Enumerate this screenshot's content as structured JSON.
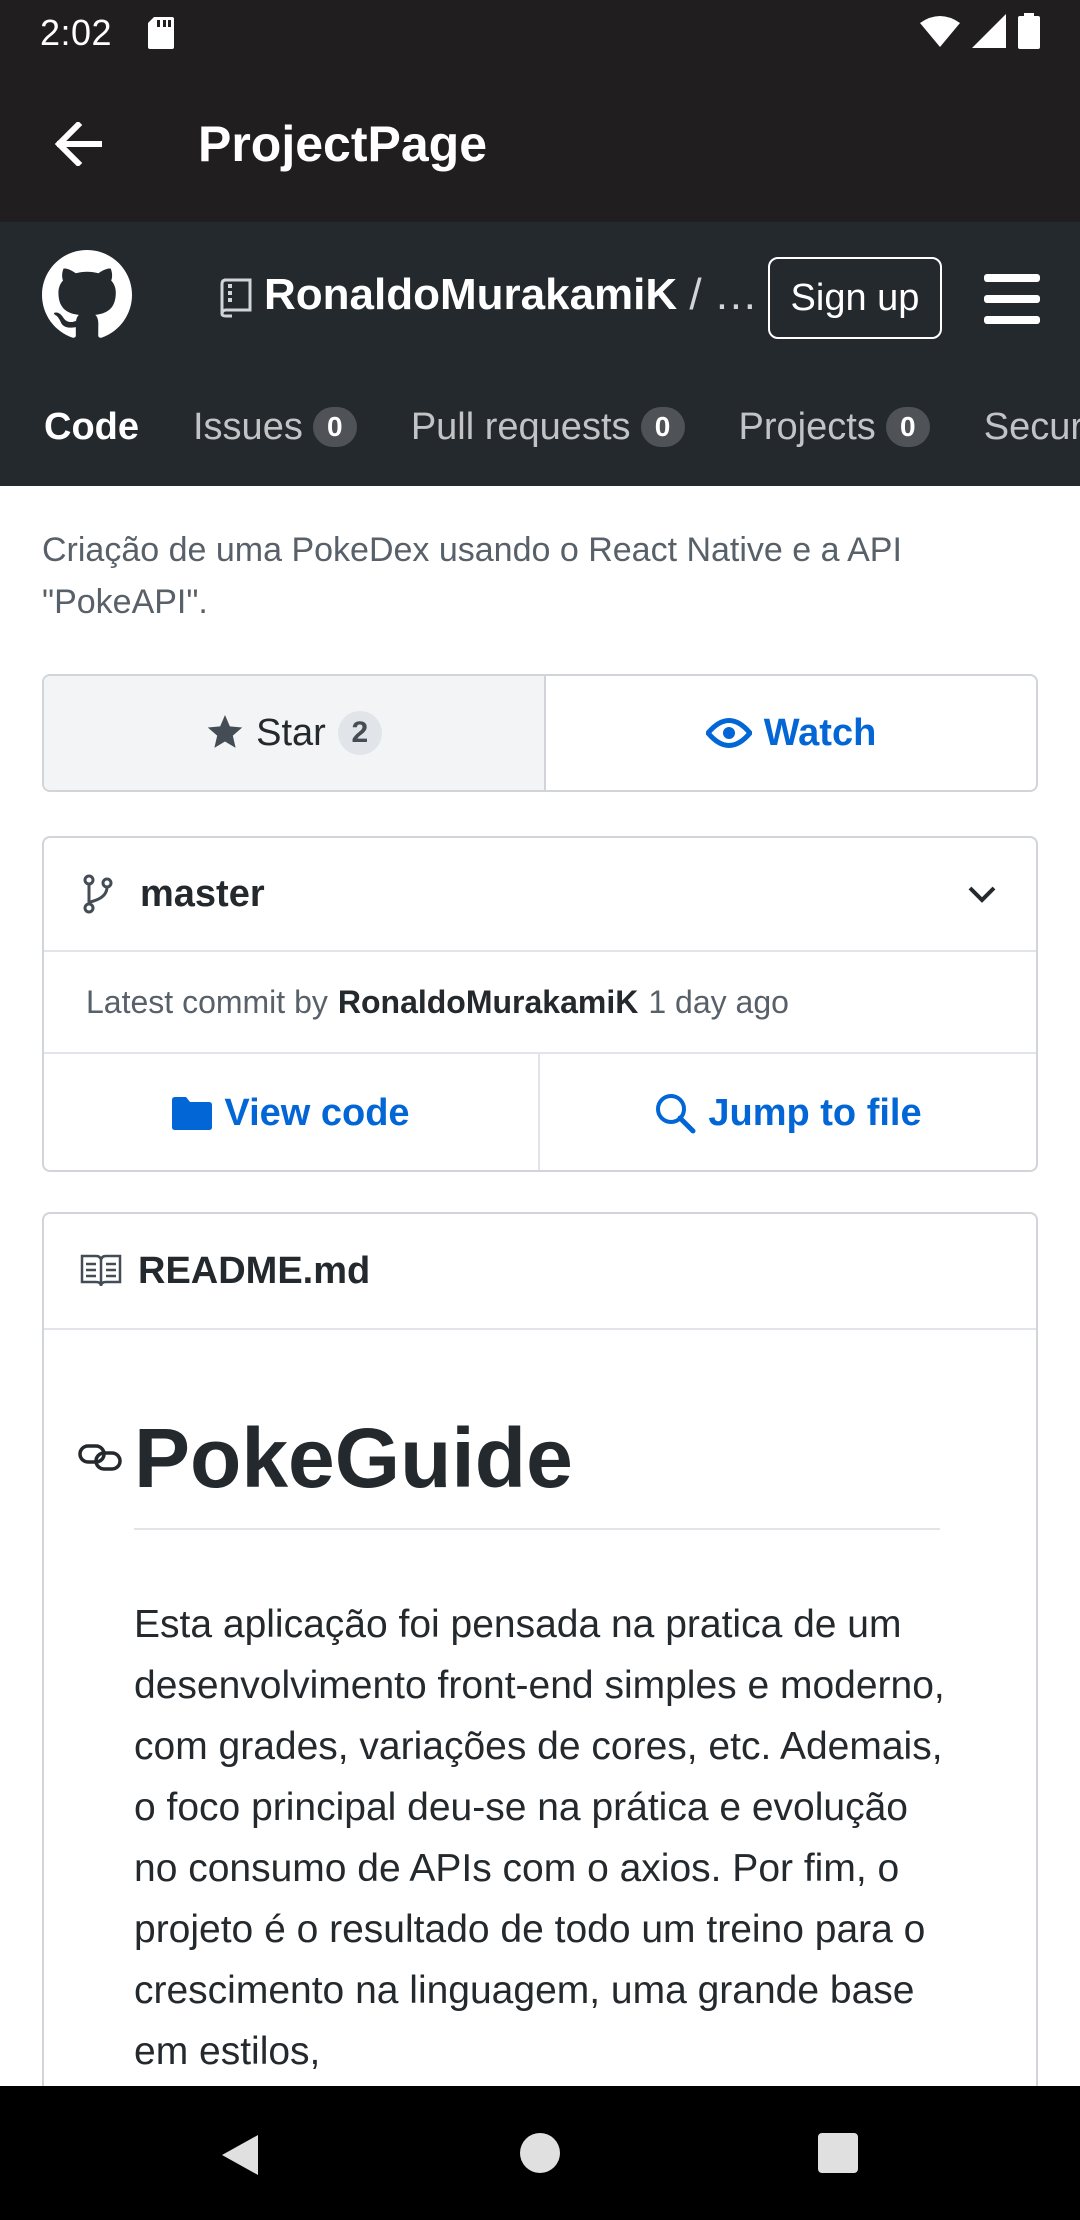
{
  "status_bar": {
    "time": "2:02"
  },
  "app_bar": {
    "title": "ProjectPage"
  },
  "github_header": {
    "repo_owner": "RonaldoMurakamiK",
    "repo_separator": "/ …",
    "sign_up_label": "Sign up",
    "tabs": [
      {
        "label": "Code",
        "counter": ""
      },
      {
        "label": "Issues",
        "counter": "0"
      },
      {
        "label": "Pull requests",
        "counter": "0"
      },
      {
        "label": "Projects",
        "counter": "0"
      },
      {
        "label": "Security",
        "counter": ""
      }
    ]
  },
  "repo": {
    "description": "Criação de uma PokeDex usando o React Native e a API \"PokeAPI\".",
    "star_label": "Star",
    "star_count": "2",
    "watch_label": "Watch"
  },
  "branch": {
    "name": "master",
    "commit_prefix": "Latest commit by",
    "commit_author": "RonaldoMurakamiK",
    "commit_time": "1 day ago",
    "view_code_label": "View code",
    "jump_to_file_label": "Jump to file"
  },
  "readme": {
    "file_name": "README.md",
    "heading": "PokeGuide",
    "body": "Esta aplicação foi pensada na pratica de um desenvolvimento front-end simples e moderno, com grades, variações de cores, etc. Ademais, o foco principal deu-se na prática e evolução no consumo de APIs com o axios. Por fim, o projeto é o resultado de todo um treino para o crescimento na linguagem, uma grande base em estilos,"
  },
  "colors": {
    "app_bar": "#201e1f",
    "github_header": "#24292e",
    "link_blue": "#0366d6",
    "muted_text": "#586069"
  },
  "icons": [
    "sd-card-icon",
    "wifi-icon",
    "signal-icon",
    "battery-icon",
    "back-arrow-icon",
    "github-logo-icon",
    "repo-icon",
    "hamburger-menu-icon",
    "star-icon",
    "eye-icon",
    "git-branch-icon",
    "chevron-down-icon",
    "folder-icon",
    "search-icon",
    "book-icon",
    "link-icon"
  ]
}
